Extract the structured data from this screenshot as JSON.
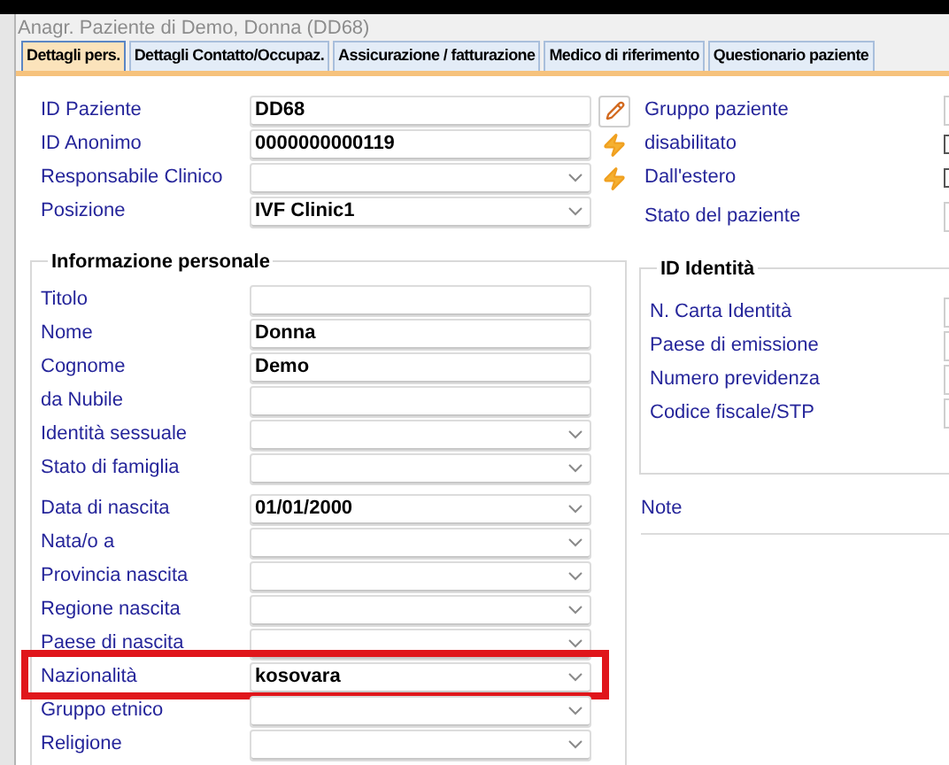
{
  "window": {
    "title": "Anagr. Paziente di Demo, Donna (DD68)"
  },
  "tabs": [
    {
      "label": "Dettagli pers.",
      "selected": true
    },
    {
      "label": "Dettagli Contatto/Occupaz.",
      "selected": false
    },
    {
      "label": "Assicurazione / fatturazione",
      "selected": false
    },
    {
      "label": "Medico di riferimento",
      "selected": false
    },
    {
      "label": "Questionario paziente",
      "selected": false
    }
  ],
  "top_fields": [
    {
      "label": "ID Paziente",
      "value": "DD68",
      "kind": "text",
      "edit": true,
      "autofill": false
    },
    {
      "label": "ID Anonimo",
      "value": "0000000000119",
      "kind": "text",
      "edit": false,
      "autofill": true
    },
    {
      "label": "Responsabile Clinico",
      "kind": "select",
      "edit": false,
      "autofill": true
    },
    {
      "label": "Posizione",
      "value": "IVF Clinic1",
      "kind": "select",
      "edit": false,
      "autofill": false
    }
  ],
  "patient_status": [
    {
      "label": "Gruppo paziente",
      "kind": "field"
    },
    {
      "label": "disabilitato",
      "kind": "checkbox",
      "checked": false
    },
    {
      "label": "Dall'estero",
      "kind": "checkbox",
      "checked": false
    },
    {
      "label": "Stato del paziente",
      "kind": "field"
    }
  ],
  "personal_info": {
    "title": "Informazione personale",
    "names": [
      {
        "label": "Titolo",
        "kind": "text",
        "highlighted": false
      },
      {
        "label": "Nome",
        "value": "Donna",
        "kind": "text",
        "highlighted": false
      },
      {
        "label": "Cognome",
        "value": "Demo",
        "kind": "text",
        "highlighted": false
      },
      {
        "label": "da Nubile",
        "kind": "text",
        "highlighted": false
      },
      {
        "label": "Identità sessuale",
        "kind": "select",
        "highlighted": false
      },
      {
        "label": "Stato di famiglia",
        "kind": "select",
        "highlighted": false
      }
    ],
    "birth": [
      {
        "label": "Data di nascita",
        "value": "01/01/2000",
        "kind": "select",
        "highlighted": false
      },
      {
        "label": "Nata/o a",
        "kind": "select",
        "highlighted": false
      },
      {
        "label": "Provincia nascita",
        "kind": "select",
        "highlighted": false
      },
      {
        "label": "Regione nascita",
        "kind": "select",
        "highlighted": false
      },
      {
        "label": "Paese di nascita",
        "kind": "select",
        "highlighted": false
      },
      {
        "label": "Nazionalità",
        "value": "kosovara",
        "kind": "select",
        "highlighted": true
      },
      {
        "label": "Gruppo etnico",
        "kind": "select",
        "highlighted": false
      },
      {
        "label": "Religione",
        "kind": "select",
        "highlighted": false
      }
    ]
  },
  "identity": {
    "title": "ID Identità",
    "fields": [
      {
        "label": "N. Carta Identità"
      },
      {
        "label": "Paese di emissione"
      },
      {
        "label": "Numero previdenza"
      },
      {
        "label": "Codice fiscale/STP"
      }
    ]
  },
  "note": {
    "label": "Note"
  }
}
